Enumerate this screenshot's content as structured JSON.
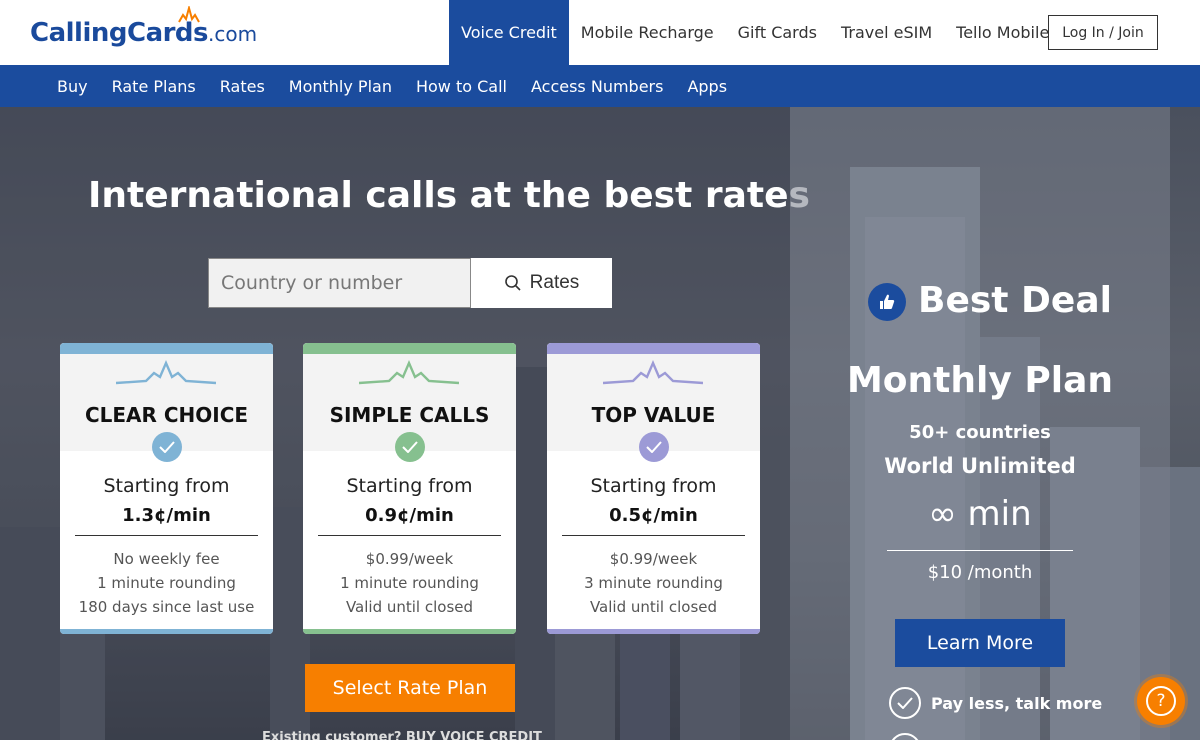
{
  "brand": {
    "name": "CallingCards",
    "suffix": ".com"
  },
  "topnav": [
    {
      "label": "Voice Credit",
      "active": true
    },
    {
      "label": "Mobile Recharge",
      "active": false
    },
    {
      "label": "Gift Cards",
      "active": false
    },
    {
      "label": "Travel eSIM",
      "active": false
    },
    {
      "label": "Tello Mobile",
      "active": false
    }
  ],
  "login_label": "Log In / Join",
  "subnav": [
    "Buy",
    "Rate Plans",
    "Rates",
    "Monthly Plan",
    "How to Call",
    "Access Numbers",
    "Apps"
  ],
  "hero": {
    "title": "International calls at the best rates",
    "search_placeholder": "Country or number",
    "search_button": "Rates"
  },
  "cards": [
    {
      "title": "CLEAR CHOICE",
      "starting": "Starting from",
      "price": "1.3¢/min",
      "features": [
        "No weekly fee",
        "1 minute rounding",
        "180 days since last use"
      ],
      "color": "#7fb3d5"
    },
    {
      "title": "SIMPLE CALLS",
      "starting": "Starting from",
      "price": "0.9¢/min",
      "features": [
        "$0.99/week",
        "1 minute rounding",
        "Valid until closed"
      ],
      "color": "#86c08f"
    },
    {
      "title": "TOP VALUE",
      "starting": "Starting from",
      "price": "0.5¢/min",
      "features": [
        "$0.99/week",
        "3 minute rounding",
        "Valid until closed"
      ],
      "color": "#9c9ad6"
    }
  ],
  "select_button": "Select Rate Plan",
  "bottom_text": "Existing customer? BUY VOICE CREDIT",
  "deal": {
    "title": "Best Deal",
    "plan": "Monthly Plan",
    "countries": "50+ countries",
    "world": "World Unlimited",
    "minutes": "∞ min",
    "price": "$10 /month",
    "button": "Learn More",
    "benefit": "Pay less, talk more"
  },
  "colors": {
    "brand_blue": "#1b4c9e",
    "accent_orange": "#f77f00"
  }
}
